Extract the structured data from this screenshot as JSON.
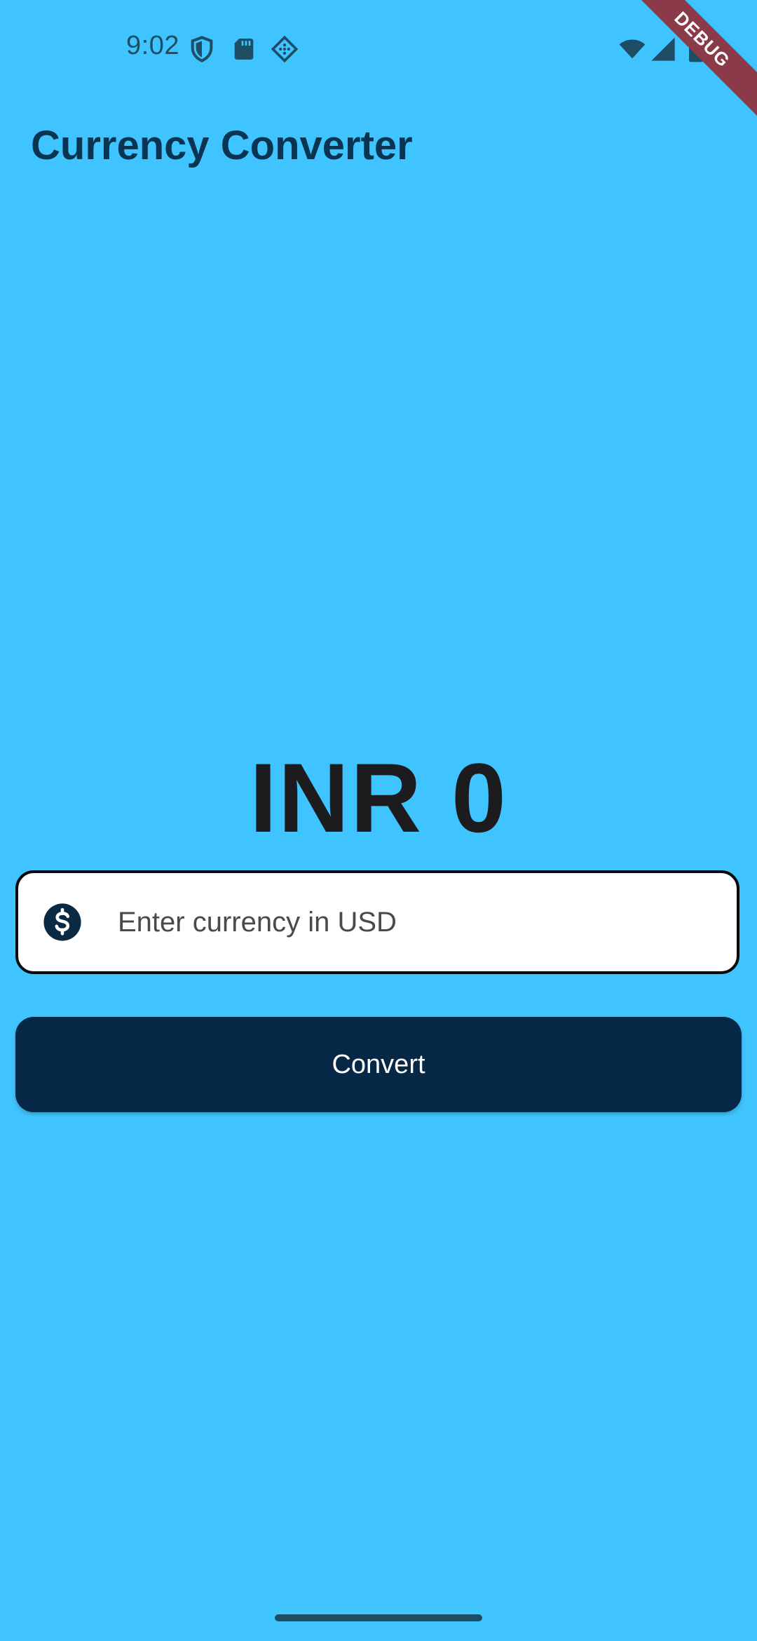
{
  "status_bar": {
    "time": "9:02",
    "icons_left": [
      "shield-icon",
      "sd-card-icon",
      "cellular-data-icon"
    ],
    "icons_right": [
      "wifi-icon",
      "signal-icon",
      "battery-icon"
    ]
  },
  "debug_banner": {
    "label": "DEBUG",
    "color": "#8B3A47"
  },
  "app_bar": {
    "title": "Currency Converter"
  },
  "result": {
    "text": "INR 0"
  },
  "input": {
    "placeholder": "Enter currency in USD",
    "value": "",
    "prefix_icon": "dollar-circle-icon"
  },
  "convert_button": {
    "label": "Convert"
  },
  "colors": {
    "background": "#40C4FF",
    "title": "#0a3552",
    "button": "#062745",
    "button_text": "#ffffff",
    "result_text": "#1c1c1e"
  }
}
